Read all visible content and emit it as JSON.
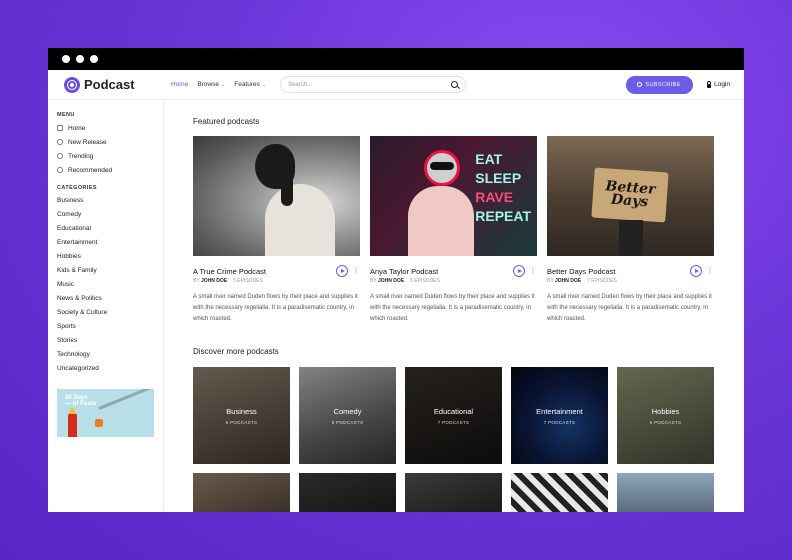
{
  "header": {
    "logo_text": "Podcast",
    "nav": [
      {
        "label": "Home"
      },
      {
        "label": "Browse"
      },
      {
        "label": "Features"
      }
    ],
    "search_placeholder": "Search...",
    "subscribe_label": "SUBSCRIBE",
    "login_label": "Login"
  },
  "sidebar": {
    "menu_heading": "MENU",
    "menu": [
      {
        "label": "Home",
        "icon": "home-icon"
      },
      {
        "label": "New Release",
        "icon": "broadcast-icon"
      },
      {
        "label": "Trending",
        "icon": "flame-icon"
      },
      {
        "label": "Recommended",
        "icon": "globe-icon"
      }
    ],
    "categories_heading": "CATEGORIES",
    "categories": [
      "Business",
      "Comedy",
      "Educational",
      "Entertainment",
      "Hobbies",
      "Kids & Family",
      "Music",
      "News & Politics",
      "Society & Culture",
      "Sports",
      "Stories",
      "Technology",
      "Uncategorized"
    ],
    "ad": {
      "line1": "30 Days",
      "line2": "— of Pasta"
    }
  },
  "featured": {
    "title": "Featured podcasts",
    "items": [
      {
        "title": "A True Crime Podcast",
        "by": "BY",
        "author": "JOHN DOE",
        "episodes": "5 EPISODES",
        "desc": "A small river named Duden flows by their place and supplies it with the necessary regelialia. It is a paradisematic country, in which roasted."
      },
      {
        "title": "Anya Taylor Podcast",
        "by": "BY",
        "author": "JOHN DOE",
        "episodes": "5 EPISODES",
        "desc": "A small river named Duden flows by their place and supplies it with the necessary regelialia. It is a paradisematic country, in which roasted."
      },
      {
        "title": "Better Days Podcast",
        "by": "BY",
        "author": "JOHN DOE",
        "episodes": "7 EPISODES",
        "desc": "A small river named Duden flows by their place and supplies it with the necessary regelialia. It is a paradisematic country, in which roasted."
      }
    ],
    "neon": {
      "l1": "EAT",
      "l2": "SLEEP",
      "l3": "RAVE",
      "l4": "REPEAT"
    },
    "sign": {
      "l1": "Better",
      "l2": "Days"
    },
    "more_glyph": "⋮"
  },
  "discover": {
    "title": "Discover more podcasts",
    "items": [
      {
        "name": "Business",
        "count": "6 PODCASTS"
      },
      {
        "name": "Comedy",
        "count": "8 PODCASTS"
      },
      {
        "name": "Educational",
        "count": "7 PODCASTS"
      },
      {
        "name": "Entertainment",
        "count": "7 PODCASTS"
      },
      {
        "name": "Hobbies",
        "count": "6 PODCASTS"
      }
    ]
  },
  "colors": {
    "accent": "#6c5ce7",
    "background": "#6b35d8"
  }
}
